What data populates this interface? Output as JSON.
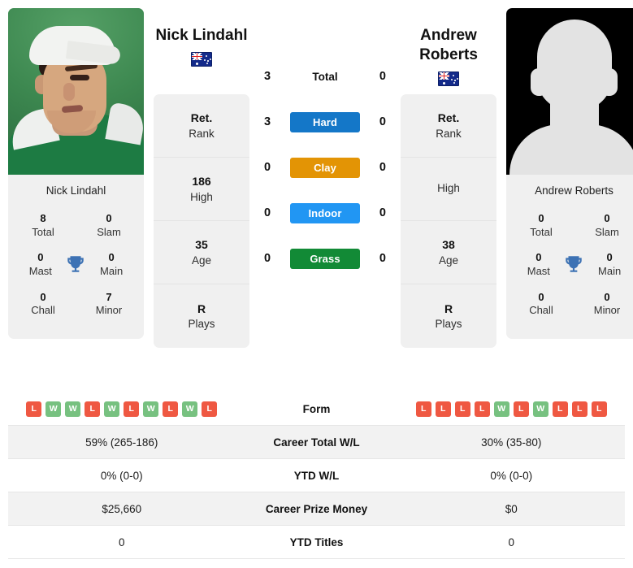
{
  "players": {
    "left": {
      "name": "Nick Lindahl",
      "name_lines": [
        "Nick Lindahl"
      ],
      "card_name": "Nick Lindahl",
      "country": "Australia",
      "flag_icon": "australia-flag-icon",
      "photo_type": "player-photo",
      "titles": {
        "total_value": "8",
        "total_label": "Total",
        "slam_value": "0",
        "slam_label": "Slam",
        "mast_value": "0",
        "mast_label": "Mast",
        "main_value": "0",
        "main_label": "Main",
        "chall_value": "0",
        "chall_label": "Chall",
        "minor_value": "7",
        "minor_label": "Minor",
        "trophy_icon": "trophy-icon"
      },
      "info": [
        {
          "value": "Ret.",
          "label": "Rank"
        },
        {
          "value": "186",
          "label": "High"
        },
        {
          "value": "35",
          "label": "Age"
        },
        {
          "value": "R",
          "label": "Plays"
        }
      ],
      "form": [
        "L",
        "W",
        "W",
        "L",
        "W",
        "L",
        "W",
        "L",
        "W",
        "L"
      ],
      "career_total_wl": "59% (265-186)",
      "ytd_wl": "0% (0-0)",
      "career_prize_money": "$25,660",
      "ytd_titles": "0"
    },
    "right": {
      "name": "Andrew Roberts",
      "name_lines": [
        "Andrew",
        "Roberts"
      ],
      "card_name": "Andrew Roberts",
      "country": "Australia",
      "flag_icon": "australia-flag-icon",
      "photo_type": "placeholder-avatar",
      "titles": {
        "total_value": "0",
        "total_label": "Total",
        "slam_value": "0",
        "slam_label": "Slam",
        "mast_value": "0",
        "mast_label": "Mast",
        "main_value": "0",
        "main_label": "Main",
        "chall_value": "0",
        "chall_label": "Chall",
        "minor_value": "0",
        "minor_label": "Minor",
        "trophy_icon": "trophy-icon"
      },
      "info": [
        {
          "value": "Ret.",
          "label": "Rank"
        },
        {
          "value": "",
          "label": "High"
        },
        {
          "value": "38",
          "label": "Age"
        },
        {
          "value": "R",
          "label": "Plays"
        }
      ],
      "form": [
        "L",
        "L",
        "L",
        "L",
        "W",
        "L",
        "W",
        "L",
        "L",
        "L"
      ],
      "career_total_wl": "30% (35-80)",
      "ytd_wl": "0% (0-0)",
      "career_prize_money": "$0",
      "ytd_titles": "0"
    }
  },
  "head_to_head": {
    "total": {
      "label": "Total",
      "left": "3",
      "right": "0"
    },
    "surfaces": [
      {
        "label": "Hard",
        "left": "3",
        "right": "0",
        "color": "#1477c8"
      },
      {
        "label": "Clay",
        "left": "0",
        "right": "0",
        "color": "#e39405"
      },
      {
        "label": "Indoor",
        "left": "0",
        "right": "0",
        "color": "#2196f3"
      },
      {
        "label": "Grass",
        "left": "0",
        "right": "0",
        "color": "#128a36"
      }
    ]
  },
  "comparison_rows": [
    {
      "label": "Form",
      "left": "",
      "right": "",
      "type": "form"
    },
    {
      "label": "Career Total W/L",
      "left": "59% (265-186)",
      "right": "30% (35-80)",
      "type": "text"
    },
    {
      "label": "YTD W/L",
      "left": "0% (0-0)",
      "right": "0% (0-0)",
      "type": "text"
    },
    {
      "label": "Career Prize Money",
      "left": "$25,660",
      "right": "$0",
      "type": "text"
    },
    {
      "label": "YTD Titles",
      "left": "0",
      "right": "0",
      "type": "text"
    }
  ],
  "colors": {
    "win_badge": "#77c180",
    "loss_badge": "#ef5842",
    "card_bg": "#f0f0f0",
    "row_shade": "#f2f2f2",
    "trophy": "#3d72b4"
  }
}
